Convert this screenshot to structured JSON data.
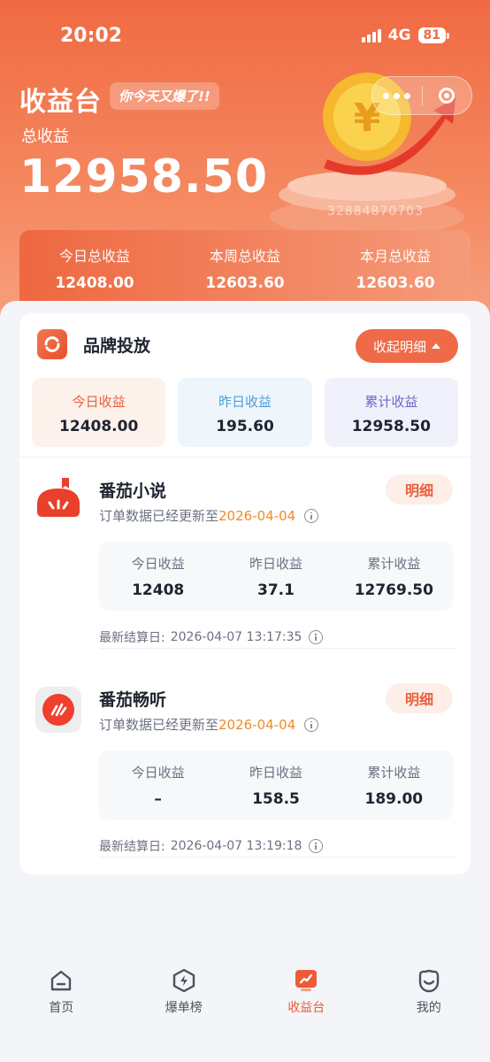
{
  "status_bar": {
    "time": "20:02",
    "network": "4G",
    "battery": "81"
  },
  "header": {
    "title": "收益台",
    "tagline": "你今天又爆了!!",
    "total_label": "总收益",
    "total_value": "12958.50",
    "watermark": "32884870703"
  },
  "summary": [
    {
      "label": "今日总收益",
      "value": "12408.00"
    },
    {
      "label": "本周总收益",
      "value": "12603.60"
    },
    {
      "label": "本月总收益",
      "value": "12603.60"
    }
  ],
  "brand": {
    "name": "品牌投放",
    "collapse_label": "收起明细",
    "stats": [
      {
        "label": "今日收益",
        "value": "12408.00"
      },
      {
        "label": "昨日收益",
        "value": "195.60"
      },
      {
        "label": "累计收益",
        "value": "12958.50"
      }
    ]
  },
  "products": [
    {
      "name": "番茄小说",
      "update_prefix": "订单数据已经更新至",
      "update_date": "2026-04-04",
      "detail_label": "明细",
      "stats": [
        {
          "label": "今日收益",
          "value": "12408"
        },
        {
          "label": "昨日收益",
          "value": "37.1"
        },
        {
          "label": "累计收益",
          "value": "12769.50"
        }
      ],
      "settle_label": "最新结算日:",
      "settle_time": "2026-04-07 13:17:35"
    },
    {
      "name": "番茄畅听",
      "update_prefix": "订单数据已经更新至",
      "update_date": "2026-04-04",
      "detail_label": "明细",
      "stats": [
        {
          "label": "今日收益",
          "value": "–"
        },
        {
          "label": "昨日收益",
          "value": "158.5"
        },
        {
          "label": "累计收益",
          "value": "189.00"
        }
      ],
      "settle_label": "最新结算日:",
      "settle_time": "2026-04-07 13:19:18"
    }
  ],
  "tabbar": [
    {
      "label": "首页",
      "icon": "home-icon"
    },
    {
      "label": "爆单榜",
      "icon": "lightning-icon"
    },
    {
      "label": "收益台",
      "icon": "earnings-icon",
      "active": true
    },
    {
      "label": "我的",
      "icon": "profile-icon"
    }
  ],
  "colors": {
    "primary": "#ee6a48",
    "accent_date": "#ef8a2a",
    "active_tab": "#ee5a36"
  }
}
